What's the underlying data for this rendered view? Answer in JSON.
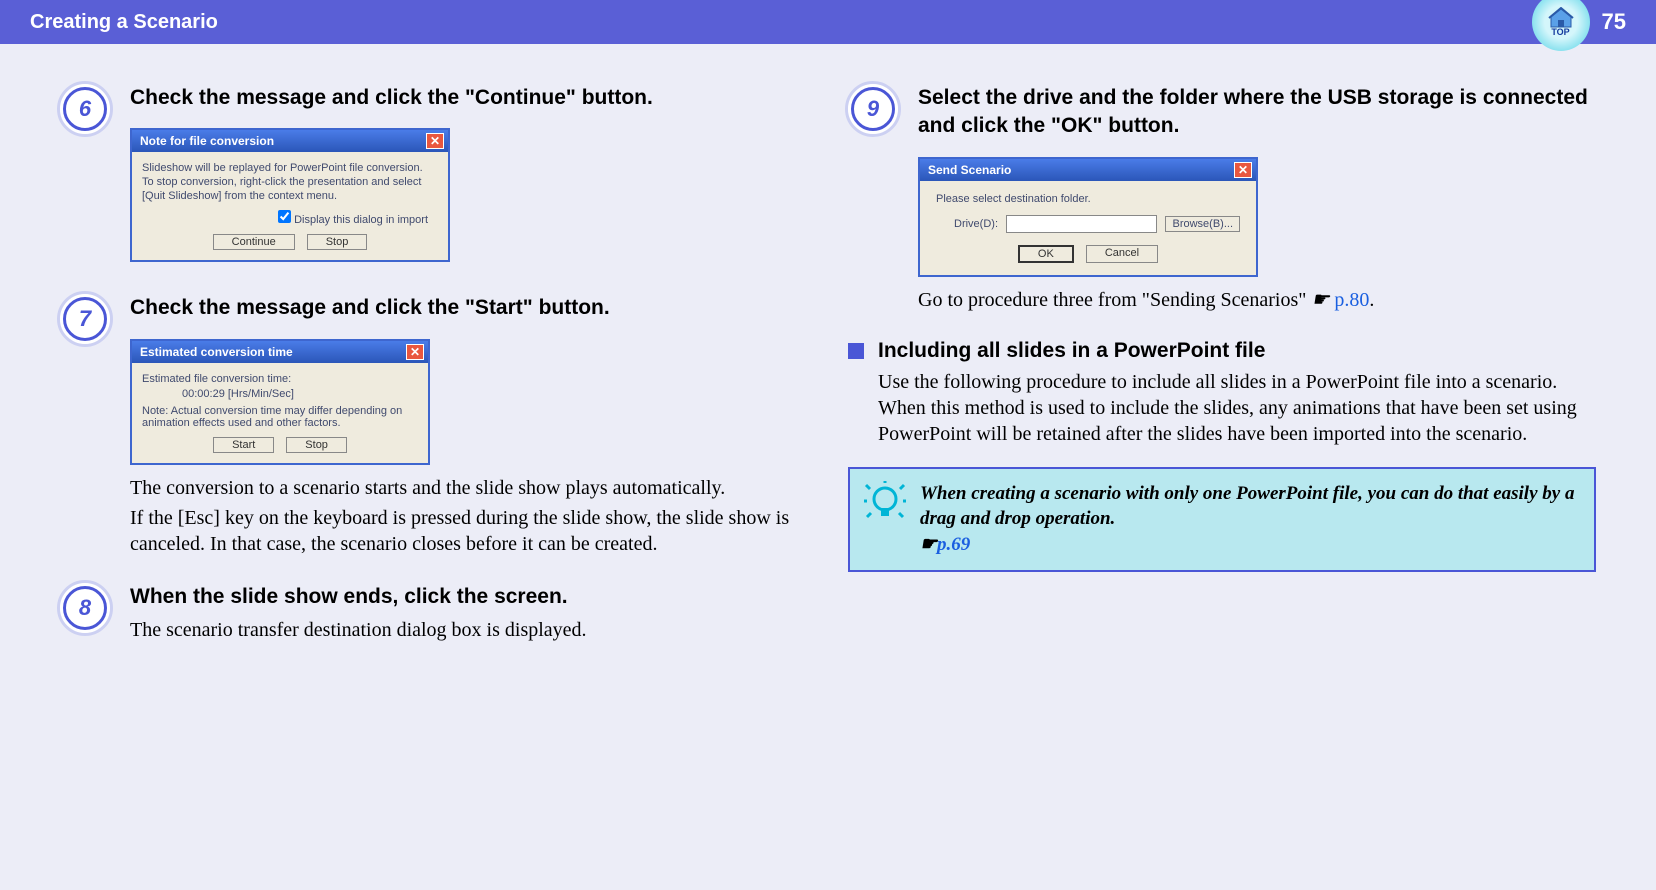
{
  "header": {
    "title": "Creating a Scenario",
    "page": "75",
    "top_label": "TOP"
  },
  "steps": {
    "s6": {
      "num": "6",
      "title": "Check the message and click the \"Continue\" button."
    },
    "s7": {
      "num": "7",
      "title": "Check the message and click the \"Start\" button.",
      "text1": "The conversion to a scenario starts and the slide show plays automatically.",
      "text2": "If the [Esc] key on the keyboard is pressed during the slide show, the slide show is canceled. In that case, the scenario closes before it can be created."
    },
    "s8": {
      "num": "8",
      "title": "When the slide show ends, click the screen.",
      "text": "The scenario transfer destination dialog box is displayed."
    },
    "s9": {
      "num": "9",
      "title": "Select the drive and the folder where the USB storage is connected and click the \"OK\" button.",
      "note_pre": "Go to procedure three from \"Sending Scenarios\" ",
      "hand": "☛",
      "link": "p.80",
      "note_post": "."
    }
  },
  "dialog1": {
    "title": "Note for file conversion",
    "l1": "Slideshow will be replayed for PowerPoint file conversion.",
    "l2": "To stop conversion, right-click the presentation and select",
    "l3": "[Quit Slideshow] from the context menu.",
    "check": "Display this dialog in import",
    "btn_continue": "Continue",
    "btn_stop": "Stop"
  },
  "dialog2": {
    "title": "Estimated conversion time",
    "l1": "Estimated file conversion time:",
    "time": "00:00:29 [Hrs/Min/Sec]",
    "l2": "Note: Actual conversion time may differ depending on animation effects used and other factors.",
    "btn_start": "Start",
    "btn_stop": "Stop"
  },
  "dialog3": {
    "title": "Send Scenario",
    "l1": "Please select destination folder.",
    "drive_label": "Drive(D):",
    "browse": "Browse(B)...",
    "btn_ok": "OK",
    "btn_cancel": "Cancel"
  },
  "subsection": {
    "title": "Including all slides in a PowerPoint file",
    "text": "Use the following procedure to include all slides in a PowerPoint file into a scenario. When this method is used to include the slides, any animations that have been set using PowerPoint will be retained after the slides have been imported into the scenario."
  },
  "tip": {
    "text": "When creating a scenario with only one PowerPoint file, you can do that easily by a drag and drop operation.",
    "hand": "☛",
    "link": "p.69"
  }
}
